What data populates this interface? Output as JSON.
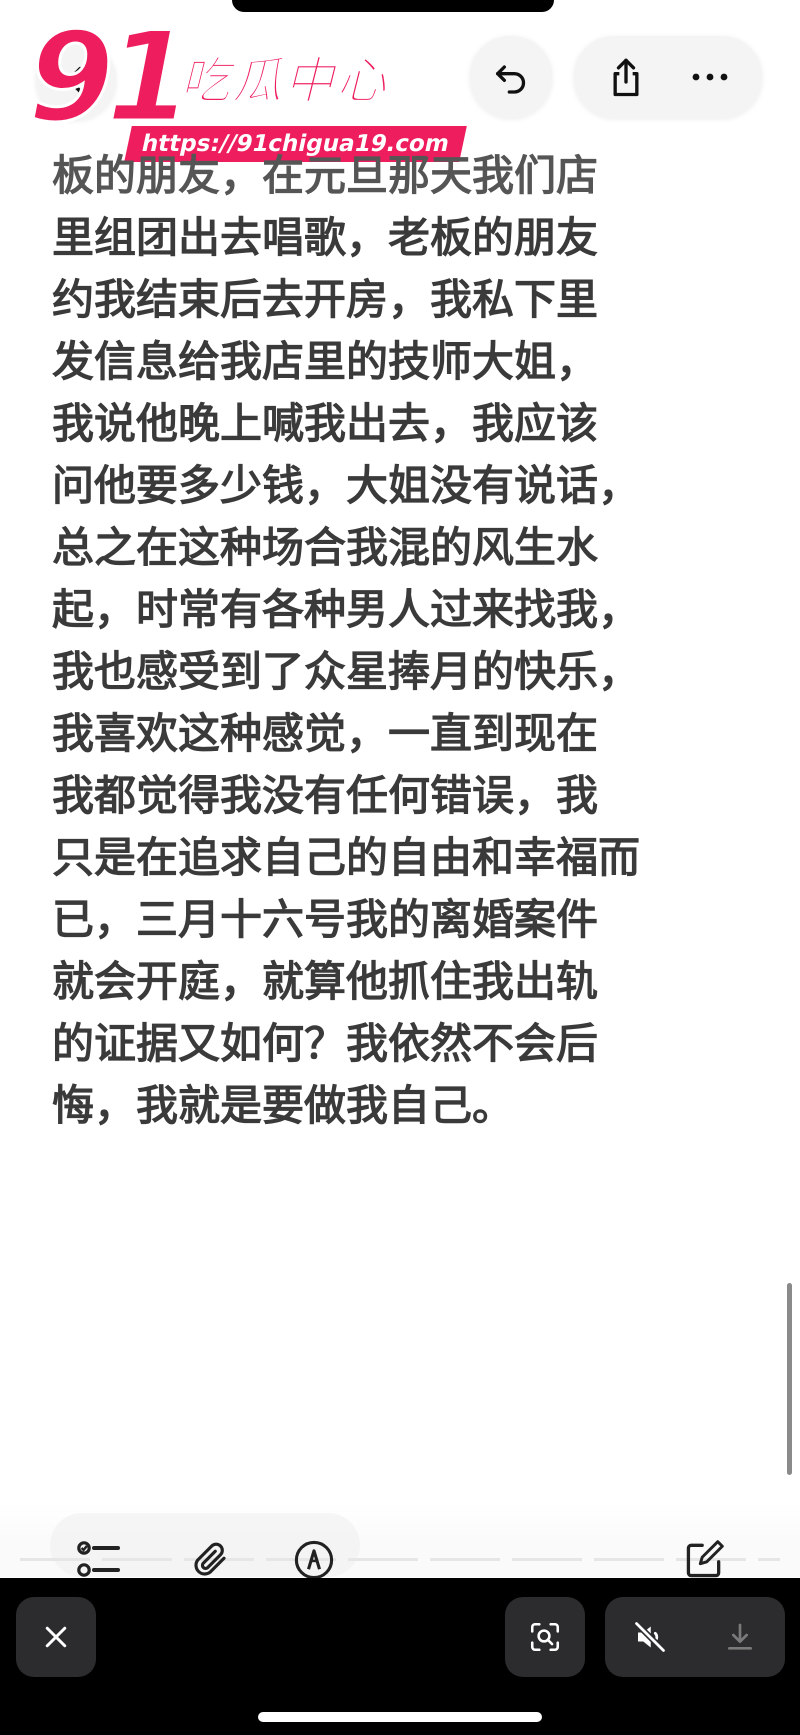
{
  "logo": {
    "number": "91",
    "name": "吃瓜中心",
    "url": "https://91chigua19.com"
  },
  "note": {
    "lines": [
      "板的朋友，在元旦那天我们店",
      "里组团出去唱歌，老板的朋友",
      "约我结束后去开房，我私下里",
      "发信息给我店里的技师大姐，",
      "我说他晚上喊我出去，我应该",
      "问他要多少钱，大姐没有说话，",
      "总之在这种场合我混的风生水",
      "起，时常有各种男人过来找我，",
      "我也感受到了众星捧月的快乐，",
      "我喜欢这种感觉，一直到现在",
      "我都觉得我没有任何错误，我",
      "只是在追求自己的自由和幸福而",
      "已，三月十六号我的离婚案件",
      "就会开庭，就算他抓住我出轨",
      "的证据又如何？我依然不会后",
      "悔，我就是要做我自己。"
    ]
  },
  "colors": {
    "logo_pink": "#ee1d5d",
    "text": "#3a3a3a",
    "bar": "#000000",
    "dark_button": "#2c2c2e"
  },
  "icons": {
    "back": "chevron-left-icon",
    "undo": "undo-icon",
    "share": "share-icon",
    "more": "more-icon",
    "checklist": "checklist-icon",
    "attach": "paperclip-icon",
    "markup": "markup-pen-icon",
    "compose": "compose-icon",
    "close": "close-icon",
    "lens": "visual-lookup-icon",
    "mute": "speaker-muted-icon",
    "download": "download-icon"
  }
}
